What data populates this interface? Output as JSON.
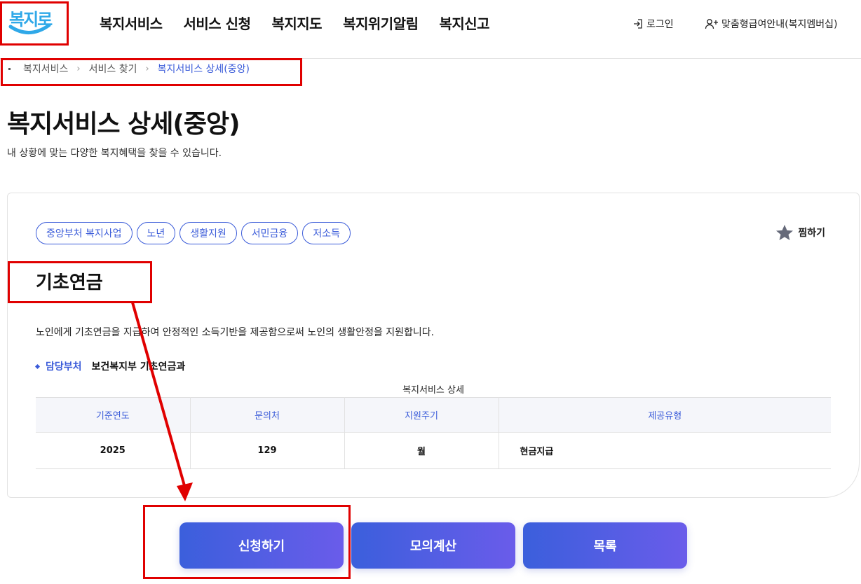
{
  "header": {
    "logo_text": "복지로",
    "nav": [
      "복지서비스",
      "서비스 신청",
      "복지지도",
      "복지위기알림",
      "복지신고"
    ],
    "login_label": "로그인",
    "member_label": "맞춤형급여안내(복지멤버십)"
  },
  "breadcrumb": {
    "items": [
      "복지서비스",
      "서비스 찾기"
    ],
    "current": "복지서비스 상세(중앙)"
  },
  "page": {
    "title": "복지서비스 상세(중앙)",
    "description": "내 상황에 맞는 다양한 복지혜택을 찾을 수 있습니다."
  },
  "service": {
    "tags": [
      "중앙부처 복지사업",
      "노년",
      "생활지원",
      "서민금융",
      "저소득"
    ],
    "favorite_label": "찜하기",
    "name": "기초연금",
    "description": "노인에게 기초연금을 지급하여 안정적인 소득기반을 제공함으로써 노인의 생활안정을 지원합니다.",
    "department_label": "담당부처",
    "department_value": "보건복지부 기초연금과",
    "table_caption": "복지서비스 상세",
    "table_headers": [
      "기준연도",
      "문의처",
      "지원주기",
      "제공유형"
    ],
    "table_row": [
      "2025",
      "129",
      "월",
      "현금지급"
    ]
  },
  "actions": {
    "apply": "신청하기",
    "simulate": "모의계산",
    "list": "목록"
  },
  "colors": {
    "accent": "#3a5bd9",
    "button_gradient_start": "#3b5fdc",
    "button_gradient_end": "#6a5cea",
    "annotation": "#e00000"
  }
}
